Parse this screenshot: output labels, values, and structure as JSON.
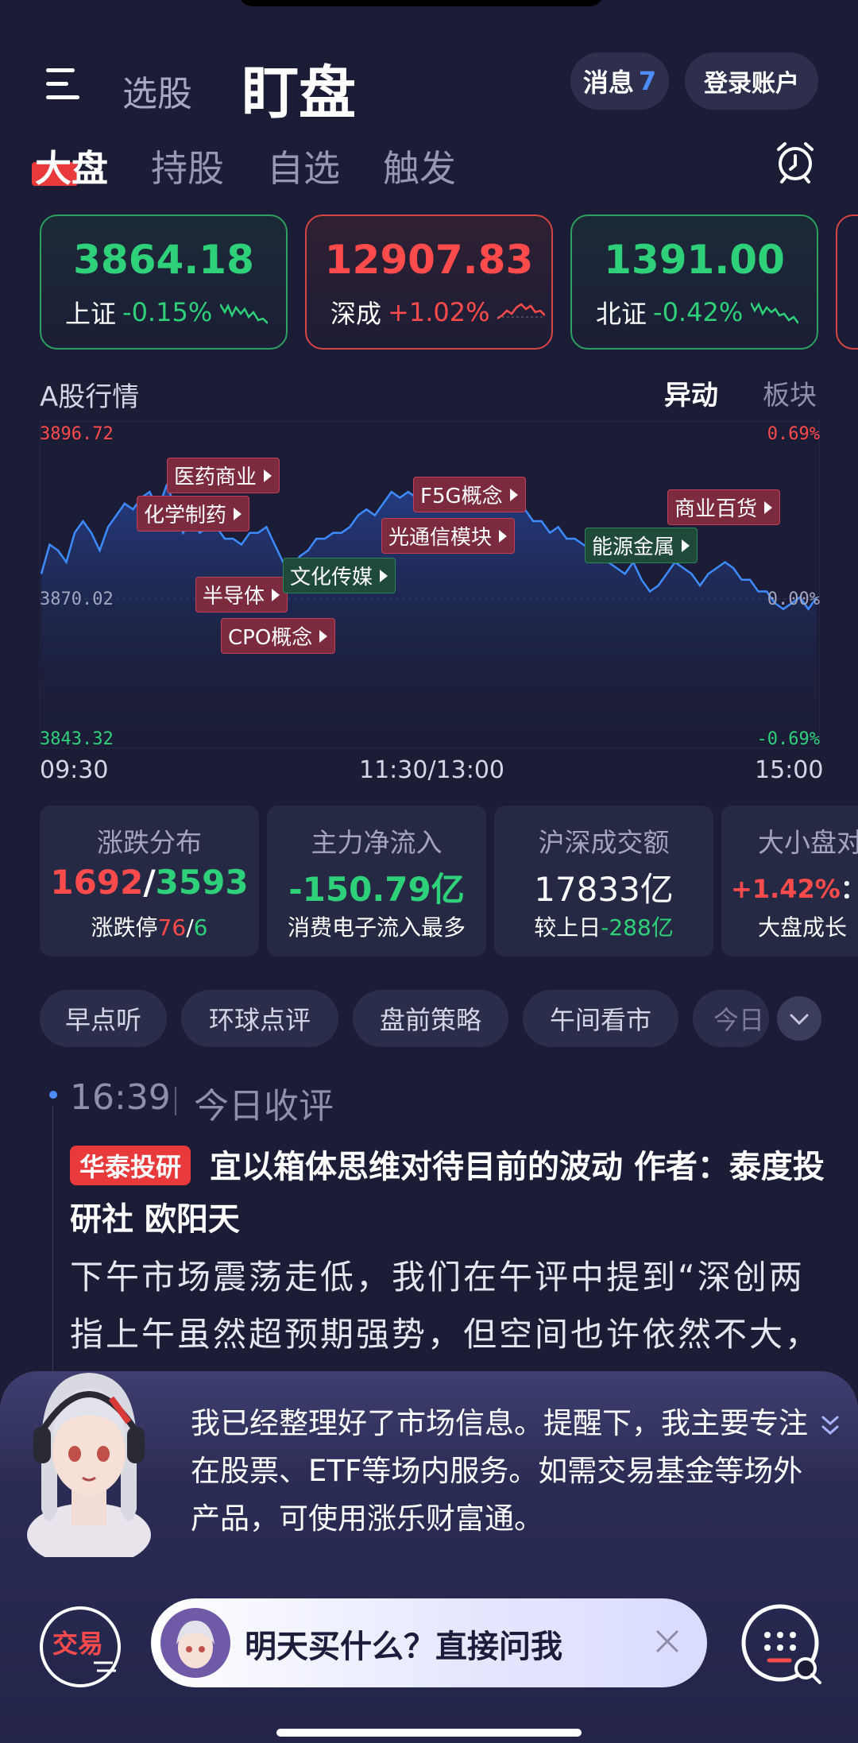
{
  "header": {
    "tab_xuangu": "选股",
    "tab_dingpan": "盯盘",
    "message_label": "消息",
    "message_count": "7",
    "login_label": "登录账户"
  },
  "subtabs": [
    "大盘",
    "持股",
    "自选",
    "触发"
  ],
  "indices": [
    {
      "value": "3864.18",
      "name": "上证",
      "change": "-0.15%",
      "trend": "down"
    },
    {
      "value": "12907.83",
      "name": "深成",
      "change": "+1.02%",
      "trend": "up"
    },
    {
      "value": "1391.00",
      "name": "北证",
      "change": "-0.42%",
      "trend": "down"
    }
  ],
  "chart_section": {
    "title": "A股行情",
    "tab_active": "异动",
    "tab_inactive": "板块"
  },
  "chart_data": {
    "type": "line",
    "y_left_top": "3896.72",
    "y_left_mid": "3870.02",
    "y_left_bottom": "3843.32",
    "y_right_top": "0.69%",
    "y_right_mid": "0.00%",
    "y_right_bottom": "-0.69%",
    "x_labels": [
      "09:30",
      "11:30/13:00",
      "15:00"
    ],
    "ylim": [
      3843.32,
      3896.72
    ],
    "series": [
      {
        "values": [
          3872,
          3877,
          3876,
          3874,
          3879,
          3881,
          3879,
          3876,
          3880,
          3882,
          3884,
          3883,
          3885,
          3886,
          3883,
          3887,
          3884,
          3879,
          3881,
          3879,
          3880,
          3880,
          3878,
          3878,
          3877,
          3879,
          3879,
          3880,
          3877,
          3874,
          3873,
          3875,
          3876,
          3878,
          3878,
          3879,
          3879,
          3880,
          3882,
          3883,
          3882,
          3884,
          3886,
          3885,
          3886,
          3885,
          3887,
          3886,
          3887,
          3886,
          3885,
          3887,
          3886,
          3888,
          3887,
          3886,
          3885,
          3883,
          3883,
          3881,
          3881,
          3879,
          3880,
          3878,
          3878,
          3877,
          3876,
          3877,
          3874,
          3873,
          3872,
          3874,
          3871,
          3869,
          3870,
          3872,
          3874,
          3873,
          3872,
          3870,
          3872,
          3873,
          3874,
          3873,
          3871,
          3871,
          3869,
          3869,
          3867,
          3866,
          3867,
          3868,
          3866,
          3868
        ]
      }
    ],
    "tags": [
      {
        "label": "医药商业",
        "color": "r"
      },
      {
        "label": "化学制药",
        "color": "r"
      },
      {
        "label": "半导体",
        "color": "r"
      },
      {
        "label": "CPO概念",
        "color": "r"
      },
      {
        "label": "文化传媒",
        "color": "g"
      },
      {
        "label": "F5G概念",
        "color": "r"
      },
      {
        "label": "光通信模块",
        "color": "r"
      },
      {
        "label": "能源金属",
        "color": "g"
      },
      {
        "label": "商业百货",
        "color": "r"
      }
    ]
  },
  "stats": [
    {
      "title": "涨跌分布",
      "up": "1692",
      "slash": "/",
      "down": "3593",
      "sub_label": "涨跌停",
      "sub_up": "76",
      "sub_slash": "/",
      "sub_down": "6"
    },
    {
      "title": "主力净流入",
      "value": "-150.79亿",
      "sub": "消费电子流入最多"
    },
    {
      "title": "沪深成交额",
      "value": "17833亿",
      "sub_label": "较上日",
      "sub_value": "-288亿"
    },
    {
      "title": "大小盘对",
      "value": "+1.42%",
      "value_tail": "：+",
      "sub": "大盘成长"
    }
  ],
  "chips": [
    "早点听",
    "环球点评",
    "盘前策略",
    "午间看市",
    "今日"
  ],
  "news": {
    "time": "16:39",
    "category": "今日收评",
    "badge": "华泰投研",
    "headline": "宜以箱体思维对待目前的波动 作者：泰度投研社 欧阳天",
    "body": "下午市场震荡走低，我们在午评中提到“深创两指上午虽然超预期强势，但空间也许依然不大，得到一定验证，如果单看日线图，三大"
  },
  "assistant": {
    "message": "我已经整理好了市场信息。提醒下，我主要专注在股票、ETF等场内服务。如需交易基金等场外产品，可使用涨乐财富通。",
    "trade_label": "交易",
    "ask_placeholder": "明天买什么？直接问我"
  },
  "colors": {
    "up": "#ff4b4b",
    "down": "#2fd07a",
    "accent": "#4d8dff",
    "bg": "#1b1d36"
  }
}
